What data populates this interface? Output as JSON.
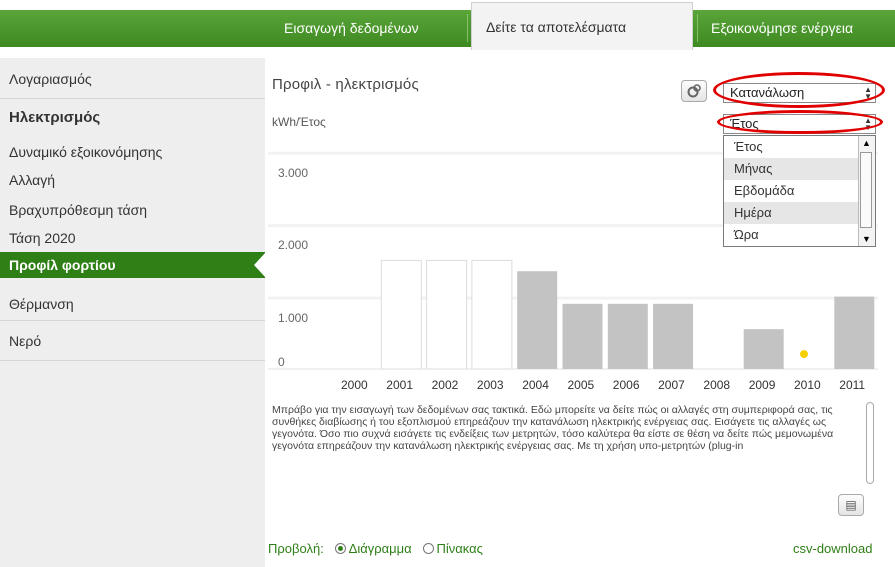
{
  "tabs": [
    {
      "label": "Εισαγωγή δεδομένων",
      "active": false
    },
    {
      "label": "Δείτε τα αποτελέσματα",
      "active": true
    },
    {
      "label": "Εξοικονόμησε ενέργεια",
      "active": false
    }
  ],
  "sidebar": {
    "items": [
      {
        "label": "Λογαριασμός"
      },
      {
        "label": "Ηλεκτρισμός"
      },
      {
        "label": "Δυναμικό εξοικονόμησης"
      },
      {
        "label": "Αλλαγή"
      },
      {
        "label": "Βραχυπρόθεσμη τάση"
      },
      {
        "label": "Τάση 2020"
      },
      {
        "label": "Προφίλ φορτίου"
      },
      {
        "label": "Θέρμανση"
      },
      {
        "label": "Νερό"
      }
    ]
  },
  "main": {
    "title": "Προφιλ - ηλεκτρισμός",
    "unit": "kWh/Έτος",
    "metric_select": "Κατανάλωση",
    "period_select": "Έτος",
    "period_options": [
      "Έτος",
      "Μήνας",
      "Εβδομάδα",
      "Ημέρα",
      "Ώρα"
    ],
    "description": "Μπράβο για την εισαγωγή των δεδομένων σας τακτικά. Εδώ μπορείτε να δείτε πώς οι αλλαγές στη συμπεριφορά σας, τις συνθήκες διαβίωσης ή του εξοπλισμού επηρεάζουν την κατανάλωση ηλεκτρικής ενέργειας σας. Εισάγετε τις αλλαγές ως γεγονότα. Όσο πιο συχνά εισάγετε τις ενδείξεις των μετρητών, τόσο καλύτερα θα είστε σε θέση να δείτε πώς μεμονωμένα γεγονότα επηρεάζουν την κατανάλωση ηλεκτρικής ενέργειας σας. Με τη χρήση υπο-μετρητών (plug-in"
  },
  "footer": {
    "view_label": "Προβολή:",
    "option_chart": "Διάγραμμα",
    "option_table": "Πίνακας",
    "csv": "csv-download"
  },
  "colors": {
    "green": "#2f7f17",
    "bar_gray": "#c3c3c3",
    "highlight_red": "#e00000",
    "dot_yellow": "#f5d000"
  },
  "chart_data": {
    "type": "bar",
    "categories": [
      "2000",
      "2001",
      "2002",
      "2003",
      "2004",
      "2005",
      "2006",
      "2007",
      "2008",
      "2009",
      "2010",
      "2011"
    ],
    "values": [
      null,
      1500,
      1500,
      1500,
      1350,
      900,
      900,
      900,
      null,
      550,
      null,
      1000
    ],
    "filled": [
      false,
      false,
      false,
      false,
      true,
      true,
      true,
      true,
      false,
      true,
      false,
      true
    ],
    "outlined": [
      false,
      true,
      true,
      true,
      true,
      false,
      false,
      false,
      false,
      false,
      false,
      false
    ],
    "point": {
      "x": "2010",
      "value": 40
    },
    "ylabel": "kWh/Έτος",
    "ylim": [
      0,
      3300
    ],
    "yticks": [
      "0",
      "1.000",
      "2.000",
      "3.000"
    ],
    "yticks_values": [
      0,
      1000,
      2000,
      3000
    ],
    "grid": true
  }
}
